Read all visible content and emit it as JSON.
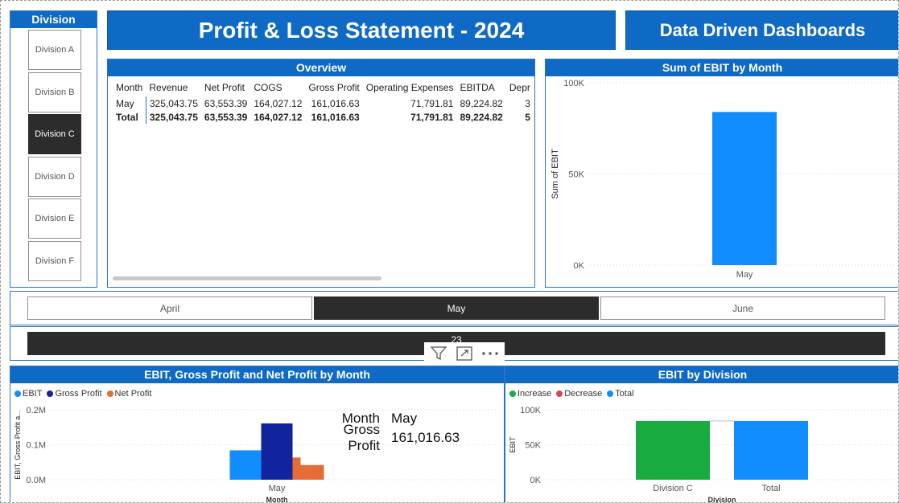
{
  "division_slicer": {
    "title": "Division",
    "items": [
      {
        "label": "Division A",
        "selected": false
      },
      {
        "label": "Division B",
        "selected": false
      },
      {
        "label": "Division C",
        "selected": true
      },
      {
        "label": "Division D",
        "selected": false
      },
      {
        "label": "Division E",
        "selected": false
      },
      {
        "label": "Division F",
        "selected": false
      }
    ]
  },
  "header": {
    "title": "Profit & Loss Statement - 2024",
    "brand": "Data Driven Dashboards"
  },
  "overview": {
    "title": "Overview",
    "columns": [
      "Month",
      "Revenue",
      "Net Profit",
      "COGS",
      "Gross Profit",
      "Operating Expenses",
      "EBITDA",
      "Depr"
    ],
    "rows": [
      [
        "May",
        "325,043.75",
        "63,553.39",
        "164,027.12",
        "161,016.63",
        "71,791.81",
        "89,224.82",
        "3"
      ],
      [
        "Total",
        "325,043.75",
        "63,553.39",
        "164,027.12",
        "161,016.63",
        "71,791.81",
        "89,224.82",
        "5"
      ]
    ]
  },
  "month_slicer": {
    "items": [
      {
        "label": "April",
        "selected": false
      },
      {
        "label": "May",
        "selected": true
      },
      {
        "label": "June",
        "selected": false
      }
    ]
  },
  "bar_slicer": {
    "label": "23"
  },
  "toolbar": {
    "icons": [
      "filter-icon",
      "focus-mode-icon",
      "more-options-icon"
    ]
  },
  "tooltip": {
    "month_key": "Month",
    "month_value": "May",
    "metric_key": "Gross Profit",
    "metric_value": "161,016.63"
  },
  "colors": {
    "accent": "#0e6ac5",
    "ebit": "#118dff",
    "gross_profit": "#12239e",
    "net_profit": "#e66c37",
    "increase": "#1aab40",
    "decrease": "#d64554",
    "total": "#118dff",
    "selected": "#2c2c2c"
  },
  "chart_data": [
    {
      "type": "bar",
      "title": "Sum of EBIT by Month",
      "xlabel": "",
      "ylabel": "Sum of EBIT",
      "categories": [
        "May"
      ],
      "values": [
        84000
      ],
      "ylim": [
        0,
        100000
      ],
      "yticks": [
        "0K",
        "50K",
        "100K"
      ],
      "grid": true
    },
    {
      "type": "bar",
      "title": "EBIT, Gross Profit and Net Profit by Month",
      "xlabel": "Month",
      "ylabel": "EBIT, Gross Profit a...",
      "categories": [
        "May"
      ],
      "series": [
        {
          "name": "EBIT",
          "values": [
            84000
          ]
        },
        {
          "name": "Gross Profit",
          "values": [
            161016.63
          ]
        },
        {
          "name": "Net Profit",
          "values": [
            63553.39
          ]
        }
      ],
      "extra_series_hint": "net profit shown as two stepped bars",
      "ylim": [
        0,
        200000
      ],
      "yticks": [
        "0.0M",
        "0.1M",
        "0.2M"
      ],
      "legend": "top-left",
      "grid": true
    },
    {
      "type": "bar",
      "title": "EBIT by Division",
      "xlabel": "Division",
      "ylabel": "EBIT",
      "categories": [
        "Division C",
        "Total"
      ],
      "series": [
        {
          "name": "Increase",
          "values": [
            84000,
            null
          ]
        },
        {
          "name": "Decrease",
          "values": [
            null,
            null
          ]
        },
        {
          "name": "Total",
          "values": [
            null,
            84000
          ]
        }
      ],
      "ylim": [
        0,
        100000
      ],
      "yticks": [
        "0K",
        "50K",
        "100K"
      ],
      "legend": "top-left",
      "grid": true
    }
  ]
}
